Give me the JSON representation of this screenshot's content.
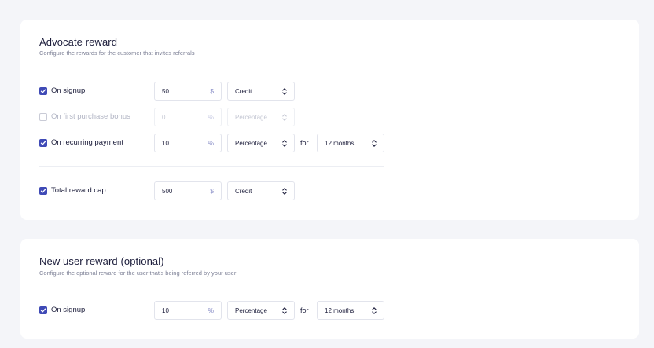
{
  "advocate": {
    "title": "Advocate reward",
    "subtitle": "Configure the rewards for the customer that invites referrals",
    "rows": [
      {
        "checked": true,
        "label": "On signup",
        "value": "50",
        "unit": "$",
        "type": "Credit"
      },
      {
        "checked": false,
        "label": "On first purchase bonus",
        "value": "0",
        "unit": "%",
        "type": "Percentage"
      },
      {
        "checked": true,
        "label": "On recurring payment",
        "value": "10",
        "unit": "%",
        "type": "Percentage",
        "for_label": "for",
        "period": "12 months"
      },
      {
        "checked": true,
        "label": "Total reward cap",
        "value": "500",
        "unit": "$",
        "type": "Credit"
      }
    ]
  },
  "new_user": {
    "title": "New user reward (optional)",
    "subtitle": "Configure the optional reward for the user that's being referred by your user",
    "rows": [
      {
        "checked": true,
        "label": "On signup",
        "value": "10",
        "unit": "%",
        "type": "Percentage",
        "for_label": "for",
        "period": "12 months"
      }
    ]
  },
  "colors": {
    "page_background": "#f4f5f9",
    "card_background": "#ffffff",
    "accent": "#3f4ab6",
    "unit_color": "#8b90c8",
    "text": "#1c1d3b",
    "muted": "#7d8096"
  },
  "icons": {
    "checkbox": "check-icon",
    "select": "updown-chevron-icon"
  }
}
